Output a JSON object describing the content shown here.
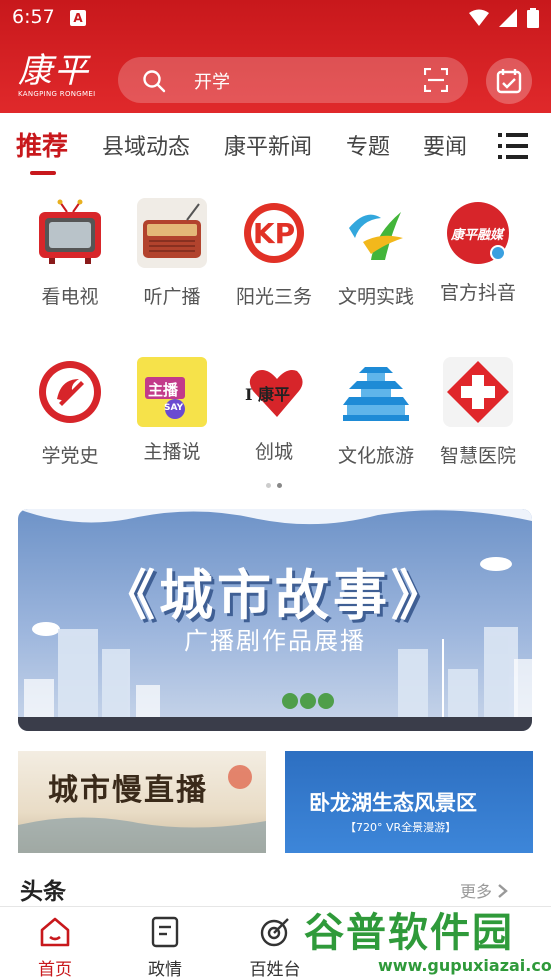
{
  "status": {
    "time": "6:57",
    "notice_letter": "A"
  },
  "header": {
    "logo_text": "康平",
    "logo_sub": "KANGPING RONGMEI",
    "search_text": "开学"
  },
  "tabs": [
    {
      "label": "推荐"
    },
    {
      "label": "县域动态"
    },
    {
      "label": "康平新闻"
    },
    {
      "label": "专题"
    },
    {
      "label": "要闻"
    }
  ],
  "grid": [
    {
      "label": "看电视",
      "icon": "tv-icon"
    },
    {
      "label": "听广播",
      "icon": "radio-icon"
    },
    {
      "label": "阳光三务",
      "icon": "kp-logo-icon"
    },
    {
      "label": "文明实践",
      "icon": "civilization-icon"
    },
    {
      "label": "官方抖音",
      "icon": "douyin-icon",
      "badge_text": "康平融媒"
    },
    {
      "label": "学党史",
      "icon": "party-emblem-icon"
    },
    {
      "label": "主播说",
      "icon": "anchor-icon",
      "badge_text": "主播",
      "badge_sub": "SAY"
    },
    {
      "label": "创城",
      "icon": "heart-city-icon",
      "badge_text": "I 康平"
    },
    {
      "label": "文化旅游",
      "icon": "pagoda-icon"
    },
    {
      "label": "智慧医院",
      "icon": "hospital-cross-icon"
    }
  ],
  "banner": {
    "title": "《城市故事》",
    "subtitle": "广播剧作品展播"
  },
  "cards": [
    {
      "title": "城市慢直播"
    },
    {
      "title": "卧龙湖生态风景区",
      "sub": "【720° VR全景漫游】"
    }
  ],
  "headline": {
    "title": "头条",
    "more": "更多"
  },
  "bottom_nav": [
    {
      "label": "首页"
    },
    {
      "label": "政情"
    },
    {
      "label": "百姓台"
    }
  ],
  "watermark": {
    "text": "谷普软件园",
    "url": "www.gupuxiazai.com"
  },
  "colors": {
    "brand_red": "#c8181c",
    "text_gray": "#555555",
    "watermark_green": "#2f9a3a"
  }
}
